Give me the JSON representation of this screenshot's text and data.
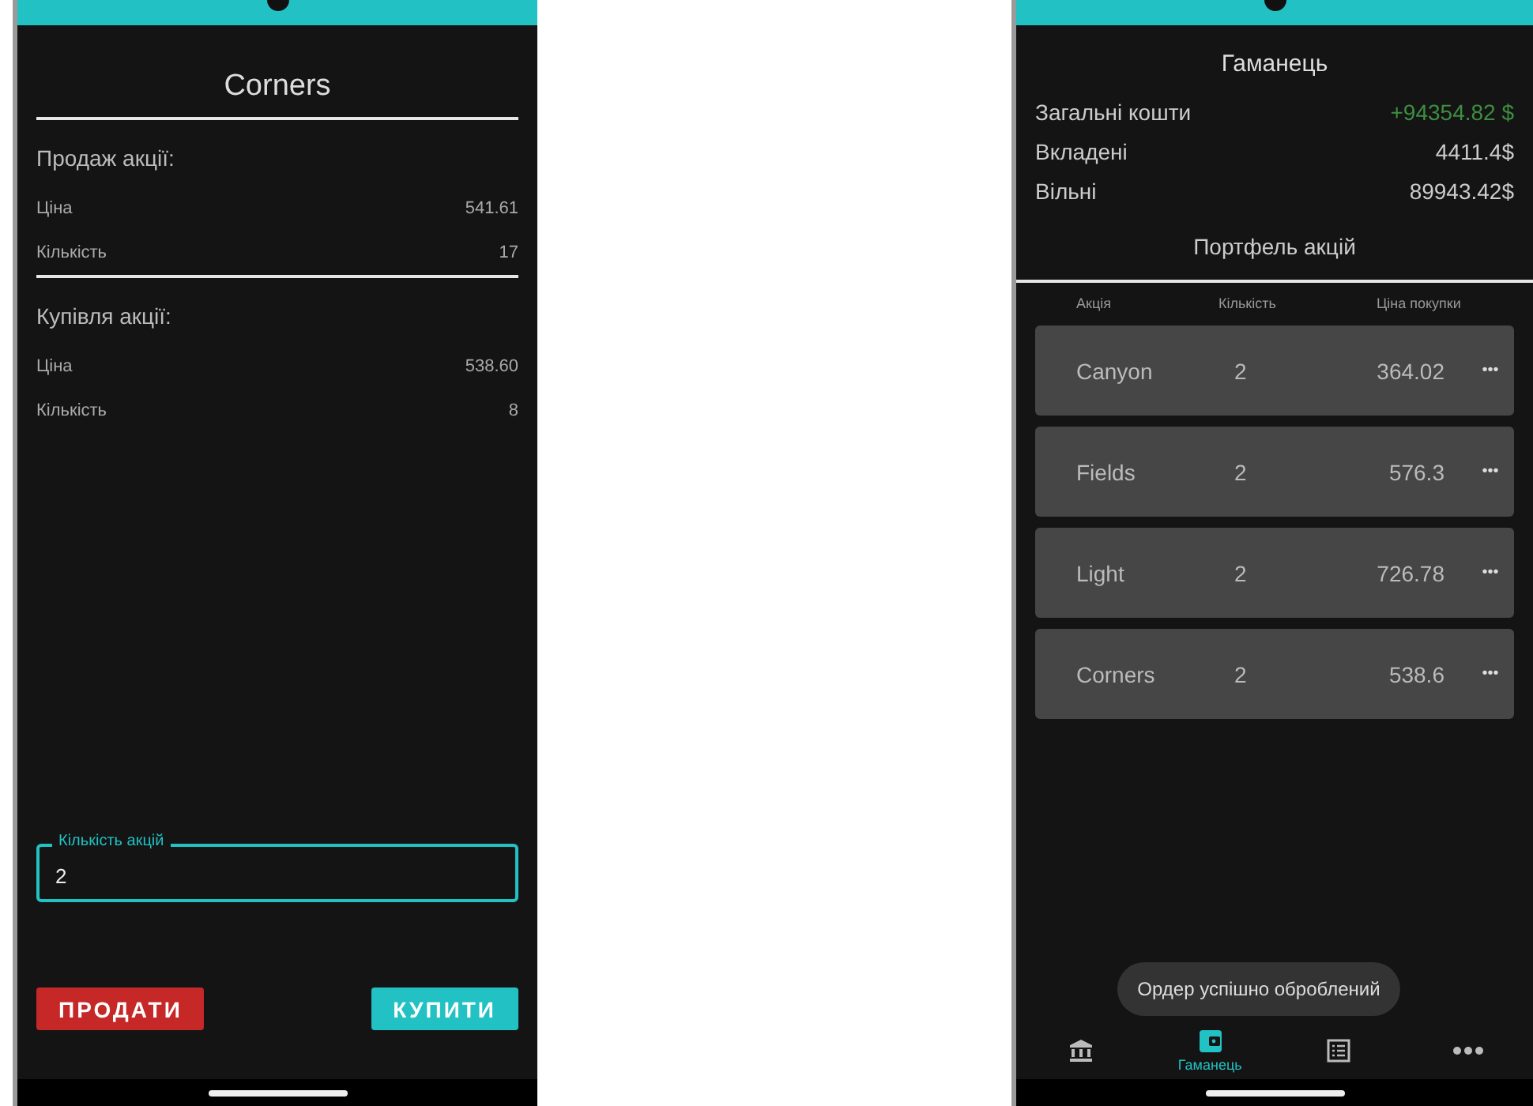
{
  "trade_screen": {
    "title": "Corners",
    "sections": [
      {
        "heading": "Продаж акції:",
        "rows": [
          {
            "label": "Ціна",
            "value": "541.61"
          },
          {
            "label": "Кількість",
            "value": "17"
          }
        ]
      },
      {
        "heading": "Купівля акції:",
        "rows": [
          {
            "label": "Ціна",
            "value": "538.60"
          },
          {
            "label": "Кількість",
            "value": "8"
          }
        ]
      }
    ],
    "quantity_field": {
      "label": "Кількість акцій",
      "value": "2"
    },
    "buttons": [
      {
        "label": "ПРОДАТИ",
        "kind": "sell"
      },
      {
        "label": "КУПИТИ",
        "kind": "buy"
      }
    ]
  },
  "wallet_screen": {
    "title": "Гаманець",
    "totals": [
      {
        "label": "Загальні кошти",
        "value": "+94354.82 $",
        "positive": true
      },
      {
        "label": "Вкладені",
        "value": "4411.4$",
        "positive": false
      },
      {
        "label": "Вільні",
        "value": "89943.42$",
        "positive": false
      }
    ],
    "portfolio_title": "Портфель акцій",
    "columns": [
      "Акція",
      "Кількість",
      "Ціна покупки"
    ],
    "holdings": [
      {
        "name": "Canyon",
        "quantity": "2",
        "price": "364.02"
      },
      {
        "name": "Fields",
        "quantity": "2",
        "price": "576.3"
      },
      {
        "name": "Light",
        "quantity": "2",
        "price": "726.78"
      },
      {
        "name": "Corners",
        "quantity": "2",
        "price": "538.6"
      }
    ],
    "more_glyph": "•••",
    "toast": "Ордер успішно оброблений",
    "nav": [
      {
        "kind": "bank",
        "selected": false
      },
      {
        "kind": "wallet",
        "label": "Гаманець",
        "selected": true
      },
      {
        "kind": "list",
        "selected": false
      },
      {
        "kind": "more",
        "selected": false
      }
    ]
  }
}
